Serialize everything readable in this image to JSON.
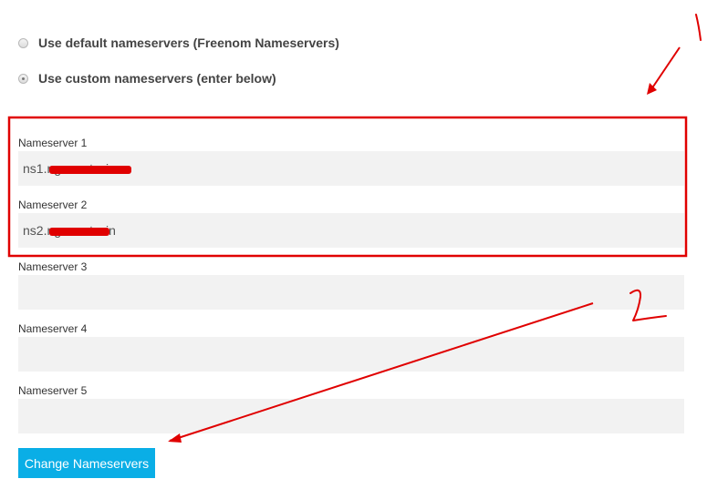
{
  "options": {
    "default_label": "Use default nameservers (Freenom Nameservers)",
    "custom_label": "Use custom nameservers (enter below)",
    "selected": "custom"
  },
  "nameservers": [
    {
      "label": "Nameserver 1",
      "value": "ns1.ng        t.win"
    },
    {
      "label": "Nameserver 2",
      "value": "ns2.ng        t.win"
    },
    {
      "label": "Nameserver 3",
      "value": ""
    },
    {
      "label": "Nameserver 4",
      "value": ""
    },
    {
      "label": "Nameserver 5",
      "value": ""
    }
  ],
  "submit_label": "Change Nameservers",
  "colors": {
    "button": "#0aaee6",
    "input_bg": "#f2f2f2",
    "annotation": "#e00000"
  }
}
